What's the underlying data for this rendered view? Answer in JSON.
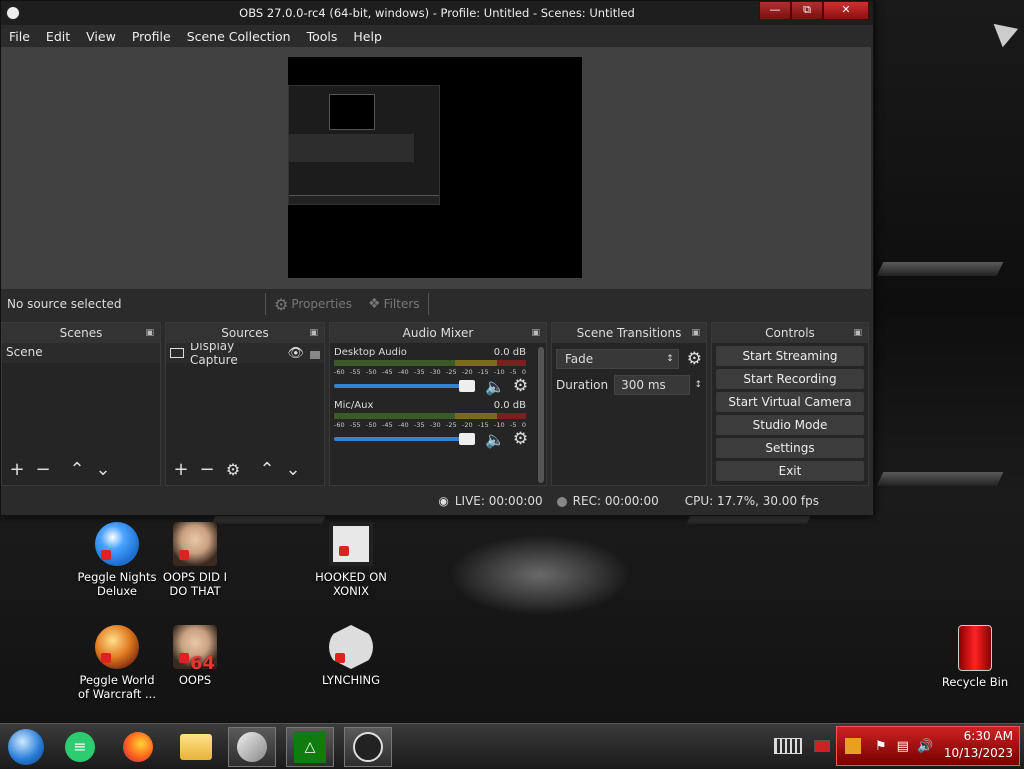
{
  "window": {
    "title": "OBS 27.0.0-rc4 (64-bit, windows) - Profile: Untitled - Scenes: Untitled",
    "controls": [
      "minimize",
      "maximize",
      "close"
    ]
  },
  "menu": [
    "File",
    "Edit",
    "View",
    "Profile",
    "Scene Collection",
    "Tools",
    "Help"
  ],
  "source_toolbar": {
    "no_source": "No source selected",
    "properties": "Properties",
    "filters": "Filters"
  },
  "docks": {
    "scenes": {
      "title": "Scenes",
      "items": [
        "Scene"
      ]
    },
    "sources": {
      "title": "Sources",
      "items": [
        "Display Capture"
      ]
    },
    "audio_mixer": {
      "title": "Audio Mixer",
      "ticks": [
        "-60",
        "-55",
        "-50",
        "-45",
        "-40",
        "-35",
        "-30",
        "-25",
        "-20",
        "-15",
        "-10",
        "-5",
        "0"
      ],
      "channels": [
        {
          "name": "Desktop Audio",
          "level": "0.0 dB",
          "volume": 1.0
        },
        {
          "name": "Mic/Aux",
          "level": "0.0 dB",
          "volume": 1.0
        }
      ]
    },
    "scene_transitions": {
      "title": "Scene Transitions",
      "transition": "Fade",
      "duration_label": "Duration",
      "duration_value": "300 ms"
    },
    "controls": {
      "title": "Controls",
      "buttons": [
        "Start Streaming",
        "Start Recording",
        "Start Virtual Camera",
        "Studio Mode",
        "Settings",
        "Exit"
      ]
    }
  },
  "status": {
    "live": "LIVE: 00:00:00",
    "rec": "REC: 00:00:00",
    "cpu": "CPU: 17.7%, 30.00 fps"
  },
  "desktop_icons": [
    {
      "label": "Peggle Nights Deluxe",
      "color": "#1e6fd0"
    },
    {
      "label": "OOPS DID I DO THAT",
      "color": "#c8a080"
    },
    {
      "label": "HOOKED ON XONIX",
      "color": "#e8e8e8"
    },
    {
      "label": "Peggle World of Warcraft ...",
      "color": "#e07a20"
    },
    {
      "label": "OOPS",
      "color": "#c8a080",
      "overlay": "64"
    },
    {
      "label": "LYNCHING",
      "color": "#dddddd"
    },
    {
      "label": "Recycle Bin",
      "color": "#dd1111"
    }
  ],
  "taskbar": {
    "items": [
      "start-orb-icon",
      "notes-app-icon",
      "firefox-icon",
      "file-explorer-icon",
      "sketchup-pro-icon",
      "xbox-icon",
      "obs-icon"
    ],
    "clock_time": "6:30 AM",
    "clock_date": "10/13/2023"
  }
}
